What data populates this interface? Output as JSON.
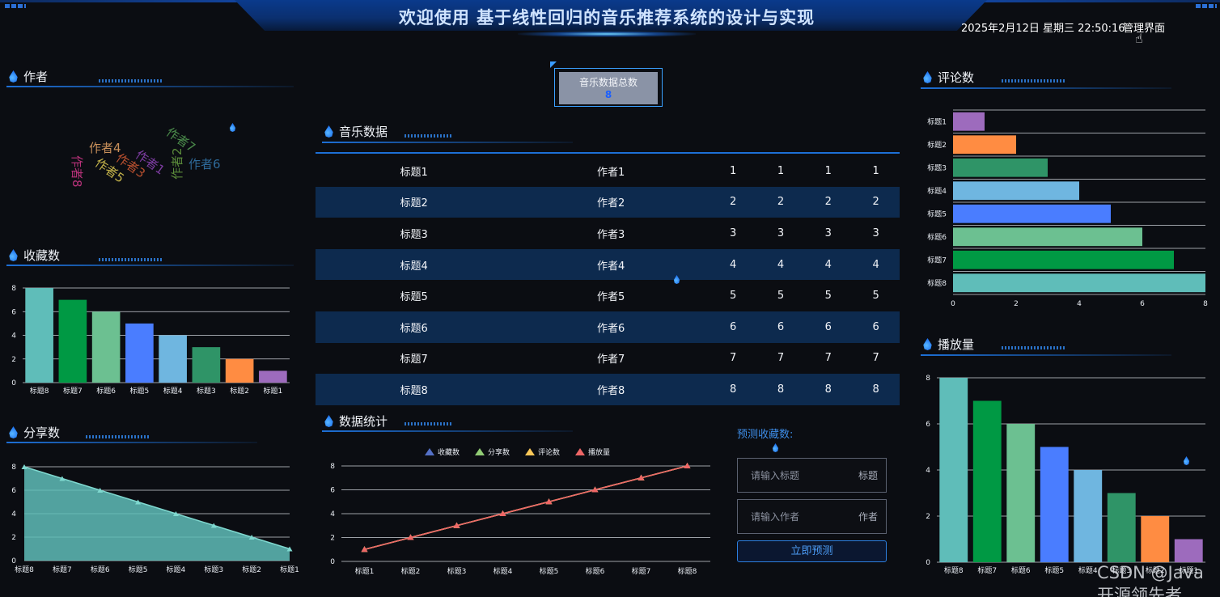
{
  "header": {
    "title": "欢迎使用 基于线性回归的音乐推荐系统的设计与实现",
    "datetime": "2025年2月12日 星期三 22:50:16",
    "admin_link": "管理界面"
  },
  "sections": {
    "author": "作者",
    "favorites": "收藏数",
    "shares": "分享数",
    "music_data": "音乐数据",
    "stats": "数据统计",
    "comments": "评论数",
    "plays": "播放量"
  },
  "total": {
    "label": "音乐数据总数",
    "value": "8"
  },
  "authors_cloud": [
    "作者4",
    "作者8",
    "作者5",
    "作者3",
    "作者1",
    "作者7",
    "作者2",
    "作者6"
  ],
  "music_table": {
    "rows": [
      [
        "标题1",
        "作者1",
        "1",
        "1",
        "1",
        "1"
      ],
      [
        "标题2",
        "作者2",
        "2",
        "2",
        "2",
        "2"
      ],
      [
        "标题3",
        "作者3",
        "3",
        "3",
        "3",
        "3"
      ],
      [
        "标题4",
        "作者4",
        "4",
        "4",
        "4",
        "4"
      ],
      [
        "标题5",
        "作者5",
        "5",
        "5",
        "5",
        "5"
      ],
      [
        "标题6",
        "作者6",
        "6",
        "6",
        "6",
        "6"
      ],
      [
        "标题7",
        "作者7",
        "7",
        "7",
        "7",
        "7"
      ],
      [
        "标题8",
        "作者8",
        "8",
        "8",
        "8",
        "8"
      ]
    ]
  },
  "predict": {
    "label": "预测收藏数:",
    "title_placeholder": "请输入标题",
    "title_suffix": "标题",
    "author_placeholder": "请输入作者",
    "author_suffix": "作者",
    "button": "立即预测"
  },
  "watermark": "CSDN @Java开源领先者",
  "colors": {
    "bars": [
      "#5fbdb9",
      "#009944",
      "#6cc091",
      "#4a7dff",
      "#6fb6e0",
      "#2f9467",
      "#ff8c42",
      "#9d6bbd"
    ]
  },
  "chart_data": [
    {
      "type": "bar",
      "name": "favorites",
      "categories": [
        "标题8",
        "标题7",
        "标题6",
        "标题5",
        "标题4",
        "标题3",
        "标题2",
        "标题1"
      ],
      "values": [
        8,
        7,
        6,
        5,
        4,
        3,
        2,
        1
      ],
      "ylim": [
        0,
        8
      ],
      "yticks": [
        0,
        2,
        4,
        6,
        8
      ]
    },
    {
      "type": "area",
      "name": "shares",
      "categories": [
        "标题8",
        "标题7",
        "标题6",
        "标题5",
        "标题4",
        "标题3",
        "标题2",
        "标题1"
      ],
      "values": [
        8,
        7,
        6,
        5,
        4,
        3,
        2,
        1
      ],
      "ylim": [
        0,
        8
      ],
      "yticks": [
        0,
        2,
        4,
        6,
        8
      ]
    },
    {
      "type": "line",
      "name": "stats",
      "categories": [
        "标题1",
        "标题2",
        "标题3",
        "标题4",
        "标题5",
        "标题6",
        "标题7",
        "标题8"
      ],
      "legend": [
        "收藏数",
        "分享数",
        "评论数",
        "播放量"
      ],
      "legend_colors": [
        "#5470c6",
        "#91cc75",
        "#fac858",
        "#ee6666"
      ],
      "series": [
        {
          "name": "收藏数",
          "values": [
            1,
            2,
            3,
            4,
            5,
            6,
            7,
            8
          ]
        },
        {
          "name": "分享数",
          "values": [
            1,
            2,
            3,
            4,
            5,
            6,
            7,
            8
          ]
        },
        {
          "name": "评论数",
          "values": [
            1,
            2,
            3,
            4,
            5,
            6,
            7,
            8
          ]
        },
        {
          "name": "播放量",
          "values": [
            1,
            2,
            3,
            4,
            5,
            6,
            7,
            8
          ]
        }
      ],
      "ylim": [
        0,
        8
      ],
      "yticks": [
        0,
        2,
        4,
        6,
        8
      ]
    },
    {
      "type": "bar",
      "orientation": "horizontal",
      "name": "comments",
      "categories": [
        "标题1",
        "标题2",
        "标题3",
        "标题4",
        "标题5",
        "标题6",
        "标题7",
        "标题8"
      ],
      "values": [
        1,
        2,
        3,
        4,
        5,
        6,
        7,
        8
      ],
      "xlim": [
        0,
        8
      ],
      "xticks": [
        0,
        2,
        4,
        6,
        8
      ]
    },
    {
      "type": "bar",
      "name": "plays",
      "categories": [
        "标题8",
        "标题7",
        "标题6",
        "标题5",
        "标题4",
        "标题3",
        "标题2",
        "标题1"
      ],
      "values": [
        8,
        7,
        6,
        5,
        4,
        3,
        2,
        1
      ],
      "ylim": [
        0,
        8
      ],
      "yticks": [
        0,
        2,
        4,
        6,
        8
      ]
    }
  ]
}
